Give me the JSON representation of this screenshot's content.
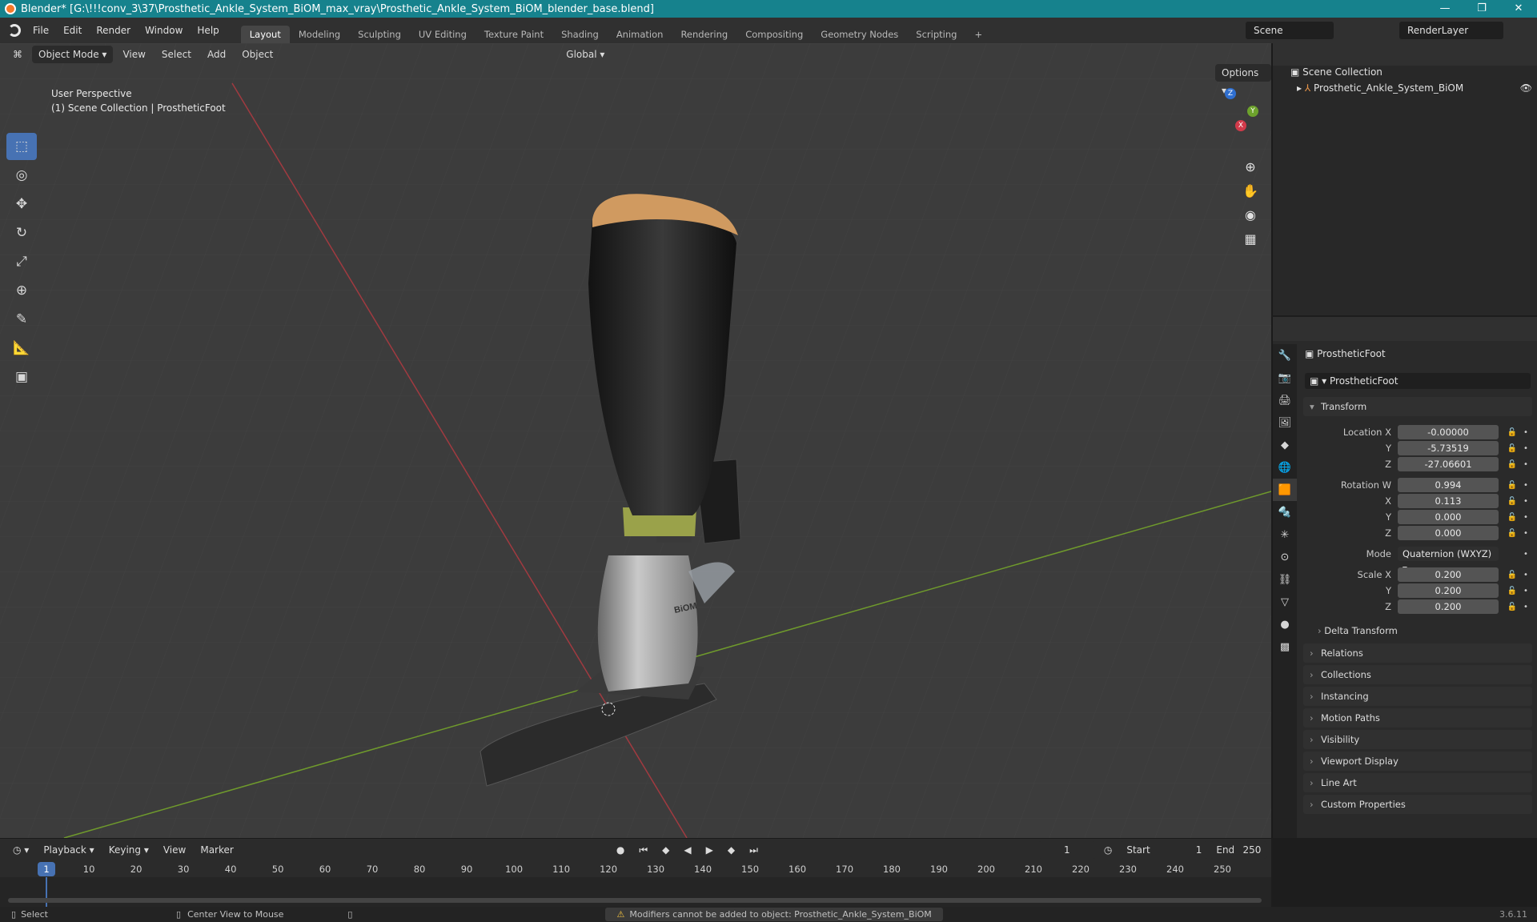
{
  "window": {
    "title": "Blender* [G:\\!!!conv_3\\37\\Prosthetic_Ankle_System_BiOM_max_vray\\Prosthetic_Ankle_System_BiOM_blender_base.blend]",
    "minimize": "—",
    "maximize": "❐",
    "close": "✕"
  },
  "menubar": {
    "menus": [
      "File",
      "Edit",
      "Render",
      "Window",
      "Help"
    ],
    "workspaces": [
      "Layout",
      "Modeling",
      "Sculpting",
      "UV Editing",
      "Texture Paint",
      "Shading",
      "Animation",
      "Rendering",
      "Compositing",
      "Geometry Nodes",
      "Scripting"
    ],
    "active_workspace": "Layout",
    "add_workspace": "+",
    "scene": "Scene",
    "view_layer": "RenderLayer"
  },
  "viewport": {
    "mode": "Object Mode",
    "menus": [
      "View",
      "Select",
      "Add",
      "Object"
    ],
    "orientation": "Global",
    "options": "Options",
    "perspective_label": "User Perspective",
    "collection_label": "(1) Scene Collection | ProstheticFoot",
    "model_brand_text": "BiOM",
    "gizmo_axes": {
      "z": "Z",
      "y": "Y",
      "x": "X"
    }
  },
  "outliner": {
    "root": "Scene Collection",
    "items": [
      {
        "name": "Prosthetic_Ankle_System_BiOM"
      }
    ]
  },
  "properties": {
    "object_name": "ProstheticFoot",
    "data_name": "ProstheticFoot",
    "transform_title": "Transform",
    "location_label": "Location X",
    "location": {
      "x": "-0.00000",
      "y": "-5.73519",
      "z": "-27.06601"
    },
    "rotation_label": "Rotation W",
    "rotation": {
      "w": "0.994",
      "x": "0.113",
      "y": "0.000",
      "z": "0.000"
    },
    "mode_label": "Mode",
    "mode": "Quaternion (WXYZ)",
    "scale_label": "Scale X",
    "scale": {
      "x": "0.200",
      "y": "0.200",
      "z": "0.200"
    },
    "axis_y": "Y",
    "axis_z": "Z",
    "axis_x": "X",
    "delta_transform": "Delta Transform",
    "panels": [
      "Relations",
      "Collections",
      "Instancing",
      "Motion Paths",
      "Visibility",
      "Viewport Display",
      "Line Art",
      "Custom Properties"
    ]
  },
  "timeline": {
    "menus": [
      "Playback",
      "Keying",
      "View",
      "Marker"
    ],
    "current_frame": "1",
    "start_label": "Start",
    "start": "1",
    "end_label": "End",
    "end": "250",
    "ruler_ticks": [
      "1",
      "10",
      "20",
      "30",
      "40",
      "50",
      "60",
      "70",
      "80",
      "90",
      "100",
      "110",
      "120",
      "130",
      "140",
      "150",
      "160",
      "170",
      "180",
      "190",
      "200",
      "210",
      "220",
      "230",
      "240",
      "250"
    ]
  },
  "statusbar": {
    "select": "Select",
    "center_view": "Center View to Mouse",
    "warning": "Modifiers cannot be added to object: Prosthetic_Ankle_System_BiOM",
    "version": "3.6.11"
  }
}
